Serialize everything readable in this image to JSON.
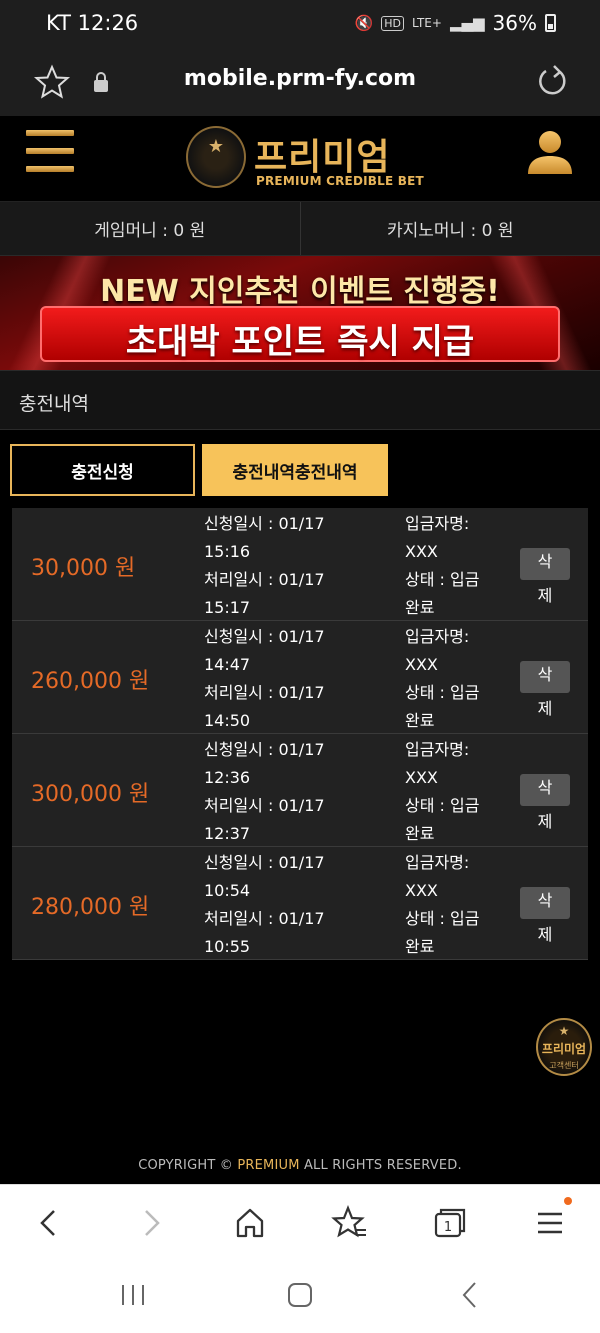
{
  "status_bar": {
    "carrier_time": "KT 12:26",
    "hd_label": "HD",
    "network": "LTE+",
    "battery": "36%"
  },
  "url_bar": {
    "url": "mobile.prm-fy.com"
  },
  "site": {
    "logo_kr": "프리미엄",
    "logo_en": "PREMIUM CREDIBLE BET"
  },
  "balances": {
    "game_money": "게임머니 : 0 원",
    "casino_money": "카지노머니 : 0 원"
  },
  "banner": {
    "line1": "NEW 지인추천 이벤트 진행중!",
    "line2": "초대박 포인트 즉시 지급"
  },
  "section_title": "충전내역",
  "tabs": {
    "apply": "충전신청",
    "history": "충전내역충전내역"
  },
  "records": [
    {
      "amount": "30,000 원",
      "req_1": "신청일시 : 01/17",
      "req_2": "15:16",
      "done_1": "처리일시 : 01/17",
      "done_2": "15:17",
      "depositor_1": "입금자명:",
      "depositor_2": "XXX",
      "status_1": "상태 : 입금",
      "status_2": "완료",
      "delete_1": "삭",
      "delete_2": "제"
    },
    {
      "amount": "260,000 원",
      "req_1": "신청일시 : 01/17",
      "req_2": "14:47",
      "done_1": "처리일시 : 01/17",
      "done_2": "14:50",
      "depositor_1": "입금자명:",
      "depositor_2": "XXX",
      "status_1": "상태 : 입금",
      "status_2": "완료",
      "delete_1": "삭",
      "delete_2": "제"
    },
    {
      "amount": "300,000 원",
      "req_1": "신청일시 : 01/17",
      "req_2": "12:36",
      "done_1": "처리일시 : 01/17",
      "done_2": "12:37",
      "depositor_1": "입금자명:",
      "depositor_2": "XXX",
      "status_1": "상태 : 입금",
      "status_2": "완료",
      "delete_1": "삭",
      "delete_2": "제"
    },
    {
      "amount": "280,000 원",
      "req_1": "신청일시 : 01/17",
      "req_2": "10:54",
      "done_1": "처리일시 : 01/17",
      "done_2": "10:55",
      "depositor_1": "입금자명:",
      "depositor_2": "XXX",
      "status_1": "상태 : 입금",
      "status_2": "완료",
      "delete_1": "삭",
      "delete_2": "제"
    }
  ],
  "support_badge": {
    "title": "프리미엄",
    "sub": "고객센터"
  },
  "footer": {
    "prefix": "COPYRIGHT © ",
    "brand": "PREMIUM",
    "suffix": " ALL RIGHTS RESERVED."
  },
  "colors": {
    "gold": "#e8b55a",
    "amount_orange": "#e56a27",
    "tab_active": "#f7c35a"
  }
}
